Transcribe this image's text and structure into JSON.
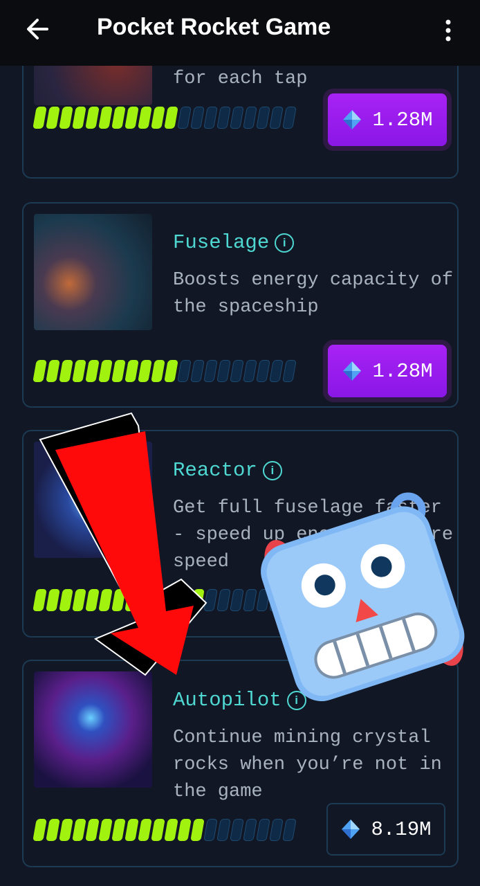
{
  "header": {
    "title": "Pocket Rocket Game",
    "back_icon": "arrow-left-icon",
    "menu_icon": "more-vertical-icon"
  },
  "colors": {
    "accent_title": "#4fd8d2",
    "progress_on": "#a2f20f",
    "progress_off": "#0f2a47",
    "buy_button": "#9b1ff0",
    "background": "#111725"
  },
  "cards": [
    {
      "title": "",
      "desc": "for each tap",
      "level": 11,
      "max_level": 20,
      "price": "1.28M",
      "button_style": "purple"
    },
    {
      "title": "Fuselage",
      "desc": "Boosts energy capacity of the spaceship",
      "level": 11,
      "max_level": 20,
      "price": "1.28M",
      "button_style": "purple"
    },
    {
      "title": "Reactor",
      "desc": "Get full fuselage faster - speed up energy restore speed",
      "level": 13,
      "max_level": 20,
      "price": "",
      "button_style": "hidden"
    },
    {
      "title": "Autopilot",
      "desc": "Continue mining crystal rocks when you’re not in the game",
      "level": 13,
      "max_level": 20,
      "price": "8.19M",
      "button_style": "plain"
    }
  ],
  "overlays": {
    "arrow": "red-arrow-down",
    "emoji": "robot-face-emoji"
  }
}
